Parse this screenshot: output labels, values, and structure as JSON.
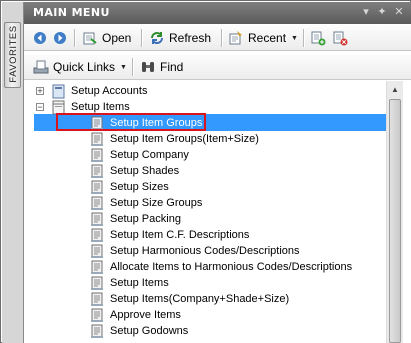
{
  "sidebar": {
    "favorites_label": "FAVORITES"
  },
  "titlebar": {
    "title": "MAIN MENU",
    "dropdown_glyph": "▾",
    "pin_glyph": "✦",
    "close_glyph": "✕"
  },
  "toolbar": {
    "open_label": "Open",
    "refresh_label": "Refresh",
    "recent_label": "Recent",
    "quick_links_label": "Quick Links",
    "find_label": "Find"
  },
  "tree": {
    "setup_accounts": {
      "label": "Setup Accounts",
      "expander": "+"
    },
    "setup_items": {
      "label": "Setup Items",
      "expander": "−"
    },
    "items": [
      "Setup Item Groups",
      "Setup Item Groups(Item+Size)",
      "Setup Company",
      "Setup Shades",
      "Setup Sizes",
      "Setup Size Groups",
      "Setup Packing",
      "Setup Item C.F. Descriptions",
      "Setup Harmonious Codes/Descriptions",
      "Allocate Items to Harmonious Codes/Descriptions",
      "Setup Items",
      "Setup Items(Company+Shade+Size)",
      "Approve Items",
      "Setup Godowns"
    ],
    "selected_index": 0
  },
  "scrollbar": {
    "up_glyph": "▲"
  },
  "colors": {
    "selection": "#3399ff",
    "highlight_box": "#d9141c",
    "titlebar": "#6b6b6b"
  }
}
